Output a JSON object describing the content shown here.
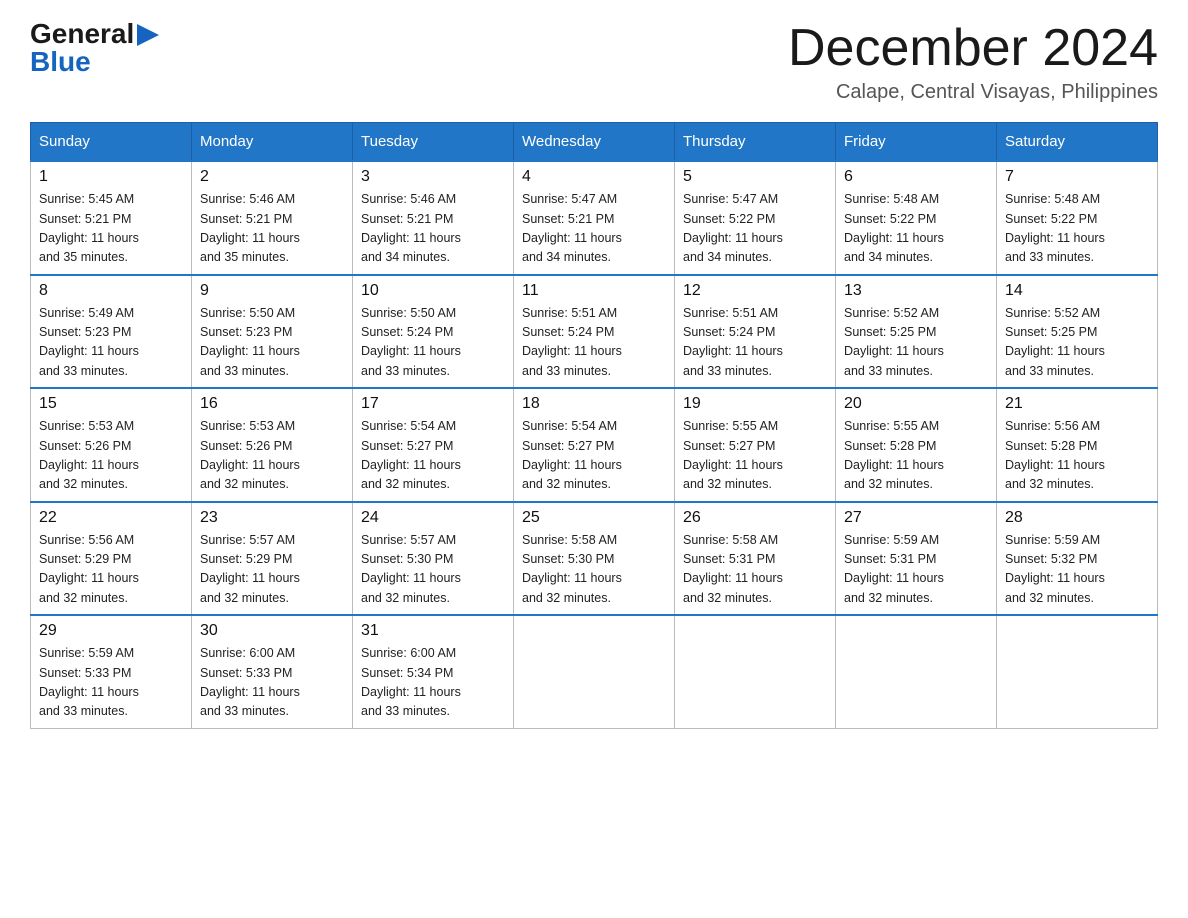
{
  "header": {
    "logo_general": "General",
    "logo_blue": "Blue",
    "month_title": "December 2024",
    "location": "Calape, Central Visayas, Philippines"
  },
  "days_of_week": [
    "Sunday",
    "Monday",
    "Tuesday",
    "Wednesday",
    "Thursday",
    "Friday",
    "Saturday"
  ],
  "weeks": [
    [
      {
        "day": "1",
        "sunrise": "5:45 AM",
        "sunset": "5:21 PM",
        "daylight": "11 hours and 35 minutes."
      },
      {
        "day": "2",
        "sunrise": "5:46 AM",
        "sunset": "5:21 PM",
        "daylight": "11 hours and 35 minutes."
      },
      {
        "day": "3",
        "sunrise": "5:46 AM",
        "sunset": "5:21 PM",
        "daylight": "11 hours and 34 minutes."
      },
      {
        "day": "4",
        "sunrise": "5:47 AM",
        "sunset": "5:21 PM",
        "daylight": "11 hours and 34 minutes."
      },
      {
        "day": "5",
        "sunrise": "5:47 AM",
        "sunset": "5:22 PM",
        "daylight": "11 hours and 34 minutes."
      },
      {
        "day": "6",
        "sunrise": "5:48 AM",
        "sunset": "5:22 PM",
        "daylight": "11 hours and 34 minutes."
      },
      {
        "day": "7",
        "sunrise": "5:48 AM",
        "sunset": "5:22 PM",
        "daylight": "11 hours and 33 minutes."
      }
    ],
    [
      {
        "day": "8",
        "sunrise": "5:49 AM",
        "sunset": "5:23 PM",
        "daylight": "11 hours and 33 minutes."
      },
      {
        "day": "9",
        "sunrise": "5:50 AM",
        "sunset": "5:23 PM",
        "daylight": "11 hours and 33 minutes."
      },
      {
        "day": "10",
        "sunrise": "5:50 AM",
        "sunset": "5:24 PM",
        "daylight": "11 hours and 33 minutes."
      },
      {
        "day": "11",
        "sunrise": "5:51 AM",
        "sunset": "5:24 PM",
        "daylight": "11 hours and 33 minutes."
      },
      {
        "day": "12",
        "sunrise": "5:51 AM",
        "sunset": "5:24 PM",
        "daylight": "11 hours and 33 minutes."
      },
      {
        "day": "13",
        "sunrise": "5:52 AM",
        "sunset": "5:25 PM",
        "daylight": "11 hours and 33 minutes."
      },
      {
        "day": "14",
        "sunrise": "5:52 AM",
        "sunset": "5:25 PM",
        "daylight": "11 hours and 33 minutes."
      }
    ],
    [
      {
        "day": "15",
        "sunrise": "5:53 AM",
        "sunset": "5:26 PM",
        "daylight": "11 hours and 32 minutes."
      },
      {
        "day": "16",
        "sunrise": "5:53 AM",
        "sunset": "5:26 PM",
        "daylight": "11 hours and 32 minutes."
      },
      {
        "day": "17",
        "sunrise": "5:54 AM",
        "sunset": "5:27 PM",
        "daylight": "11 hours and 32 minutes."
      },
      {
        "day": "18",
        "sunrise": "5:54 AM",
        "sunset": "5:27 PM",
        "daylight": "11 hours and 32 minutes."
      },
      {
        "day": "19",
        "sunrise": "5:55 AM",
        "sunset": "5:27 PM",
        "daylight": "11 hours and 32 minutes."
      },
      {
        "day": "20",
        "sunrise": "5:55 AM",
        "sunset": "5:28 PM",
        "daylight": "11 hours and 32 minutes."
      },
      {
        "day": "21",
        "sunrise": "5:56 AM",
        "sunset": "5:28 PM",
        "daylight": "11 hours and 32 minutes."
      }
    ],
    [
      {
        "day": "22",
        "sunrise": "5:56 AM",
        "sunset": "5:29 PM",
        "daylight": "11 hours and 32 minutes."
      },
      {
        "day": "23",
        "sunrise": "5:57 AM",
        "sunset": "5:29 PM",
        "daylight": "11 hours and 32 minutes."
      },
      {
        "day": "24",
        "sunrise": "5:57 AM",
        "sunset": "5:30 PM",
        "daylight": "11 hours and 32 minutes."
      },
      {
        "day": "25",
        "sunrise": "5:58 AM",
        "sunset": "5:30 PM",
        "daylight": "11 hours and 32 minutes."
      },
      {
        "day": "26",
        "sunrise": "5:58 AM",
        "sunset": "5:31 PM",
        "daylight": "11 hours and 32 minutes."
      },
      {
        "day": "27",
        "sunrise": "5:59 AM",
        "sunset": "5:31 PM",
        "daylight": "11 hours and 32 minutes."
      },
      {
        "day": "28",
        "sunrise": "5:59 AM",
        "sunset": "5:32 PM",
        "daylight": "11 hours and 32 minutes."
      }
    ],
    [
      {
        "day": "29",
        "sunrise": "5:59 AM",
        "sunset": "5:33 PM",
        "daylight": "11 hours and 33 minutes."
      },
      {
        "day": "30",
        "sunrise": "6:00 AM",
        "sunset": "5:33 PM",
        "daylight": "11 hours and 33 minutes."
      },
      {
        "day": "31",
        "sunrise": "6:00 AM",
        "sunset": "5:34 PM",
        "daylight": "11 hours and 33 minutes."
      },
      null,
      null,
      null,
      null
    ]
  ],
  "labels": {
    "sunrise": "Sunrise:",
    "sunset": "Sunset:",
    "daylight": "Daylight:"
  }
}
